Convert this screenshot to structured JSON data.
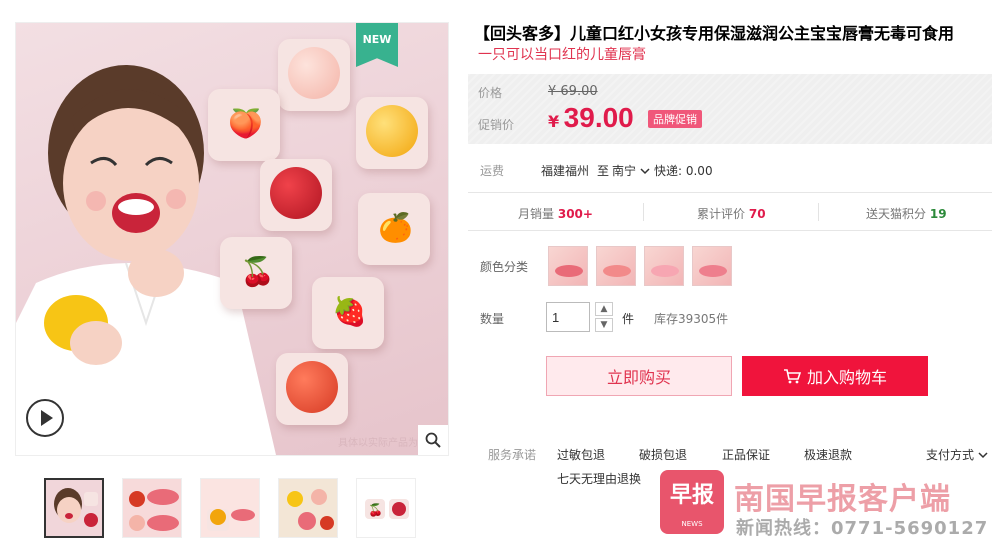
{
  "gallery": {
    "badge": "NEW",
    "watermark_small": "具体以实际产品为准",
    "thumb_count": 5
  },
  "product": {
    "title": "【回头客多】儿童口红小女孩专用保湿滋润公主宝宝唇膏无毒可食用",
    "subtitle": "一只可以当口红的儿童唇膏"
  },
  "price": {
    "list_label": "价格",
    "list_value": "¥ 69.00",
    "promo_label": "促销价",
    "currency": "¥",
    "promo_value": "39.00",
    "promo_badge": "品牌促销"
  },
  "shipping": {
    "label": "运费",
    "origin": "福建福州",
    "to_word": "至",
    "destination": "南宁",
    "fee": "快递: 0.00"
  },
  "stats": {
    "monthly_label": "月销量",
    "monthly_value": "300+",
    "reviews_label": "累计评价",
    "reviews_value": "70",
    "points_label": "送天猫积分",
    "points_value": "19"
  },
  "options": {
    "color_label": "颜色分类",
    "qty_label": "数量",
    "qty_value": "1",
    "qty_unit": "件",
    "stock": "库存39305件"
  },
  "actions": {
    "buy_now": "立即购买",
    "add_cart": "加入购物车"
  },
  "services": {
    "label": "服务承诺",
    "items": [
      "过敏包退",
      "破损包退",
      "正品保证",
      "极速退款"
    ],
    "extra": "七天无理由退换",
    "payment": "支付方式"
  },
  "watermark": {
    "logo_text": "早报",
    "logo_sub": "NEWS",
    "title": "南国早报客户端",
    "hotline": "新闻热线：0771-5690127"
  },
  "colors": {
    "accent": "#f0143c",
    "price_red": "#e01b4b",
    "subtitle_pink": "#e0334f"
  }
}
